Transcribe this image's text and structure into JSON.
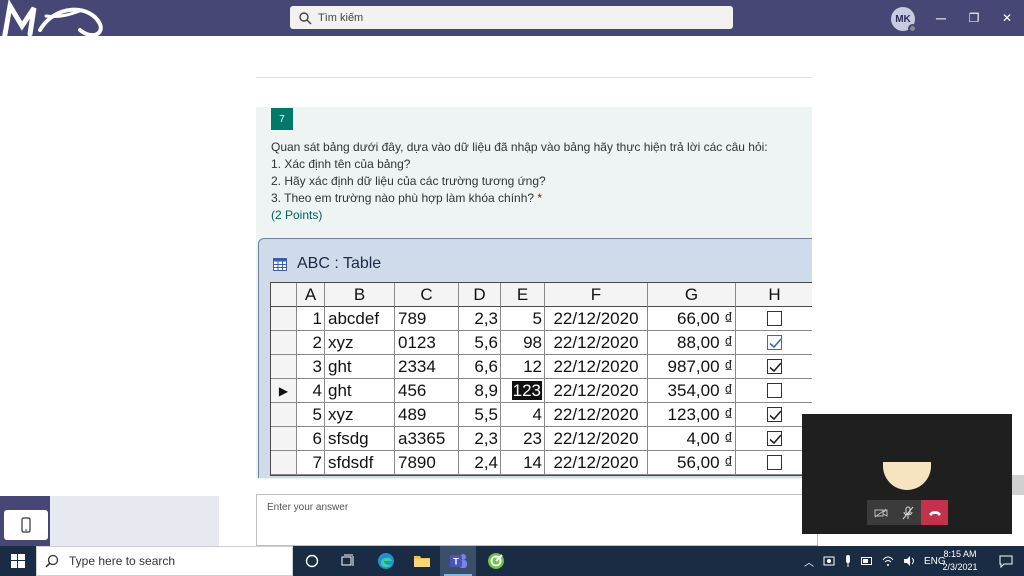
{
  "titlebar": {
    "search_placeholder": "Tìm kiếm",
    "avatar_initials": "MK",
    "minimize": "─",
    "maximize": "❐",
    "close": "✕"
  },
  "question": {
    "number": "7",
    "line1": "Quan sát bảng dưới đây, dựa vào dữ liệu đã nhập vào bảng hãy thực hiện trả lời các câu hỏi:",
    "line2": "1. Xác định tên của bảng?",
    "line3": "2. Hãy xác định dữ liệu của các trường tương ứng?",
    "line4": "3. Theo em trường nào phù hợp làm khóa chính?",
    "required_mark": "*",
    "points": "(2 Points)"
  },
  "table_image": {
    "title": "ABC : Table",
    "headers": [
      "A",
      "B",
      "C",
      "D",
      "E",
      "F",
      "G",
      "H"
    ],
    "current_row_marker": "▶",
    "rows": [
      {
        "A": "1",
        "B": "abcdef",
        "C": "789",
        "D": "2,3",
        "E": "5",
        "F": "22/12/2020",
        "G": "66,00 ₫",
        "H": false
      },
      {
        "A": "2",
        "B": "xyz",
        "C": "0123",
        "D": "5,6",
        "E": "98",
        "F": "22/12/2020",
        "G": "88,00 ₫",
        "H": true
      },
      {
        "A": "3",
        "B": "ght",
        "C": "2334",
        "D": "6,6",
        "E": "12",
        "F": "22/12/2020",
        "G": "987,00 ₫",
        "H": true
      },
      {
        "A": "4",
        "B": "ght",
        "C": "456",
        "D": "8,9",
        "E": "123",
        "F": "22/12/2020",
        "G": "354,00 ₫",
        "H": false
      },
      {
        "A": "5",
        "B": "xyz",
        "C": "489",
        "D": "5,5",
        "E": "4",
        "F": "22/12/2020",
        "G": "123,00 ₫",
        "H": true
      },
      {
        "A": "6",
        "B": "sfsdg",
        "C": "a3365",
        "D": "2,3",
        "E": "23",
        "F": "22/12/2020",
        "G": "4,00 ₫",
        "H": true
      },
      {
        "A": "7",
        "B": "sfdsdf",
        "C": "7890",
        "D": "2,4",
        "E": "14",
        "F": "22/12/2020",
        "G": "56,00 ₫",
        "H": false
      }
    ]
  },
  "answer": {
    "placeholder": "Enter your answer"
  },
  "taskbar": {
    "search_placeholder": "Type here to search",
    "language": "ENG",
    "time": "8:15 AM",
    "date": "2/3/2021"
  },
  "colors": {
    "teams_header": "#464775",
    "question_badge": "#00796b",
    "required": "#a80000",
    "end_call": "#c4314b",
    "taskbar": "#1a2c44"
  }
}
